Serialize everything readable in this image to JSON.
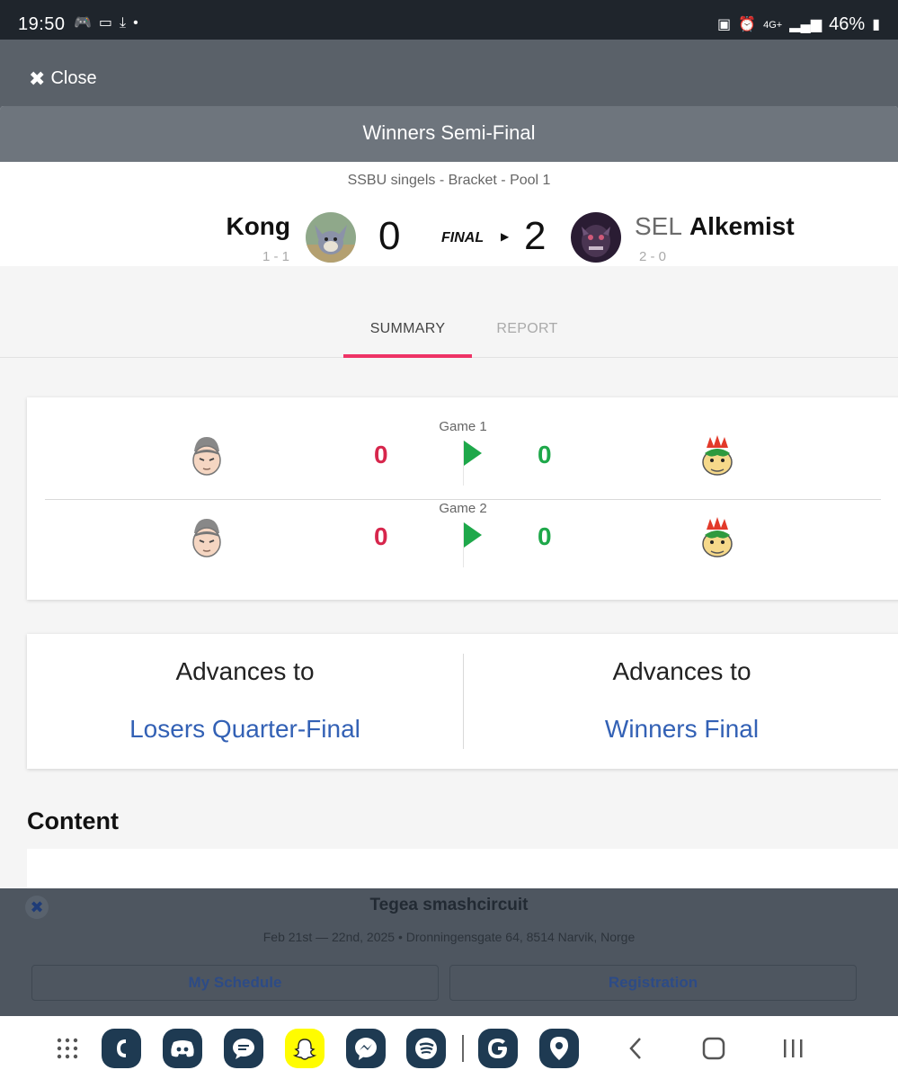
{
  "status_bar": {
    "time": "19:50",
    "battery": "46%",
    "network": "4G+"
  },
  "top_bar": {
    "close_label": "Close"
  },
  "modal": {
    "round_title": "Winners Semi-Final",
    "event_line": "SSBU singels - Bracket - Pool 1",
    "player_left": {
      "name": "Kong",
      "record": "1 - 1",
      "score": "0"
    },
    "player_right": {
      "prefix": "SEL",
      "name": "Alkemist",
      "record": "2 - 0",
      "score": "2"
    },
    "state_label": "FINAL",
    "tabs": [
      {
        "label": "SUMMARY",
        "active": true
      },
      {
        "label": "REPORT",
        "active": false
      }
    ],
    "games": [
      {
        "label": "Game 1",
        "left_score": "0",
        "right_score": "0",
        "left_character": "kazuya-icon",
        "right_character": "bowser-icon"
      },
      {
        "label": "Game 2",
        "left_score": "0",
        "right_score": "0",
        "left_character": "kazuya-icon",
        "right_character": "bowser-icon"
      }
    ],
    "advances": [
      {
        "heading": "Advances to",
        "link": "Losers Quarter-Final"
      },
      {
        "heading": "Advances to",
        "link": "Winners Final"
      }
    ],
    "content_title": "Content"
  },
  "background_page": {
    "tournament_name": "Tegea smashcircuit",
    "details": "Feb 21st — 22nd, 2025 • Dronningensgate 64, 8514 Narvik, Norge",
    "buttons": [
      "My Schedule",
      "Registration"
    ]
  },
  "nav_bar": {
    "apps": [
      "app-drawer-icon",
      "phone-icon",
      "discord-icon",
      "messages-icon",
      "snapchat-icon",
      "messenger-icon",
      "spotify-icon",
      "google-icon",
      "maps-icon"
    ],
    "controls": [
      "back-icon",
      "home-icon",
      "recents-icon"
    ]
  },
  "colors": {
    "accent_tab": "#ee3366",
    "loser_score": "#d7264c",
    "winner_score": "#1ea84a",
    "link": "#3361b5"
  }
}
